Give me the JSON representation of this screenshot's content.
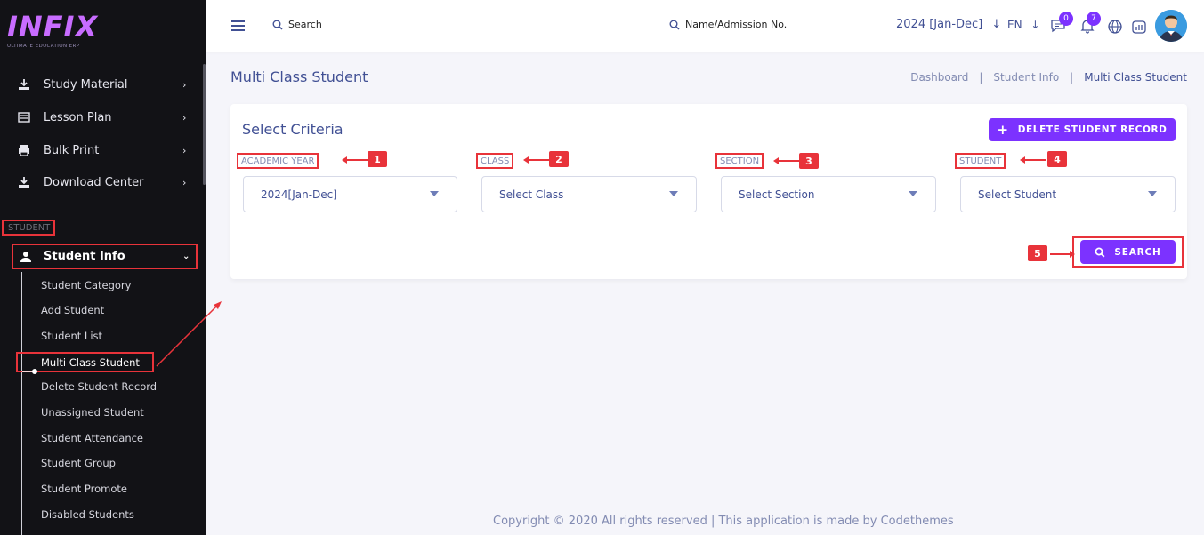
{
  "brand": {
    "name": "INFIX",
    "tagline": "ULTIMATE EDUCATION ERP"
  },
  "sidebar": {
    "items": [
      {
        "label": "Study Material",
        "icon": "download-icon"
      },
      {
        "label": "Lesson Plan",
        "icon": "list-icon"
      },
      {
        "label": "Bulk Print",
        "icon": "printer-icon"
      },
      {
        "label": "Download Center",
        "icon": "download-icon"
      }
    ],
    "section_label": "STUDENT",
    "active_group": {
      "label": "Student Info",
      "icon": "user-icon"
    },
    "sub_items": [
      "Student Category",
      "Add Student",
      "Student List",
      "Multi Class Student",
      "Delete Student Record",
      "Unassigned Student",
      "Student Attendance",
      "Student Group",
      "Student Promote",
      "Disabled Students"
    ],
    "active_sub_item": "Multi Class Student"
  },
  "header": {
    "search_label": "Search",
    "search2_label": "Name/Admission No.",
    "year": "2024 [Jan-Dec]",
    "language": "EN",
    "message_count": "0",
    "notification_count": "7"
  },
  "page": {
    "title": "Multi Class Student",
    "breadcrumb": [
      "Dashboard",
      "Student Info",
      "Multi Class Student"
    ],
    "breadcrumb_sep": "|"
  },
  "criteria": {
    "title": "Select Criteria",
    "delete_button": "DELETE STUDENT RECORD",
    "fields": [
      {
        "label": "ACADEMIC YEAR",
        "value": "2024[Jan-Dec]",
        "badge": "1"
      },
      {
        "label": "CLASS",
        "value": "Select Class",
        "badge": "2"
      },
      {
        "label": "SECTION",
        "value": "Select Section",
        "badge": "3"
      },
      {
        "label": "STUDENT",
        "value": "Select Student",
        "badge": "4"
      }
    ],
    "search_button": "SEARCH",
    "search_badge": "5"
  },
  "footer": "Copyright © 2020 All rights reserved | This application is made by Codethemes",
  "colors": {
    "accent": "#7c32ff",
    "sidebar": "#121216",
    "annotation": "#e8333a",
    "text": "#415094"
  }
}
